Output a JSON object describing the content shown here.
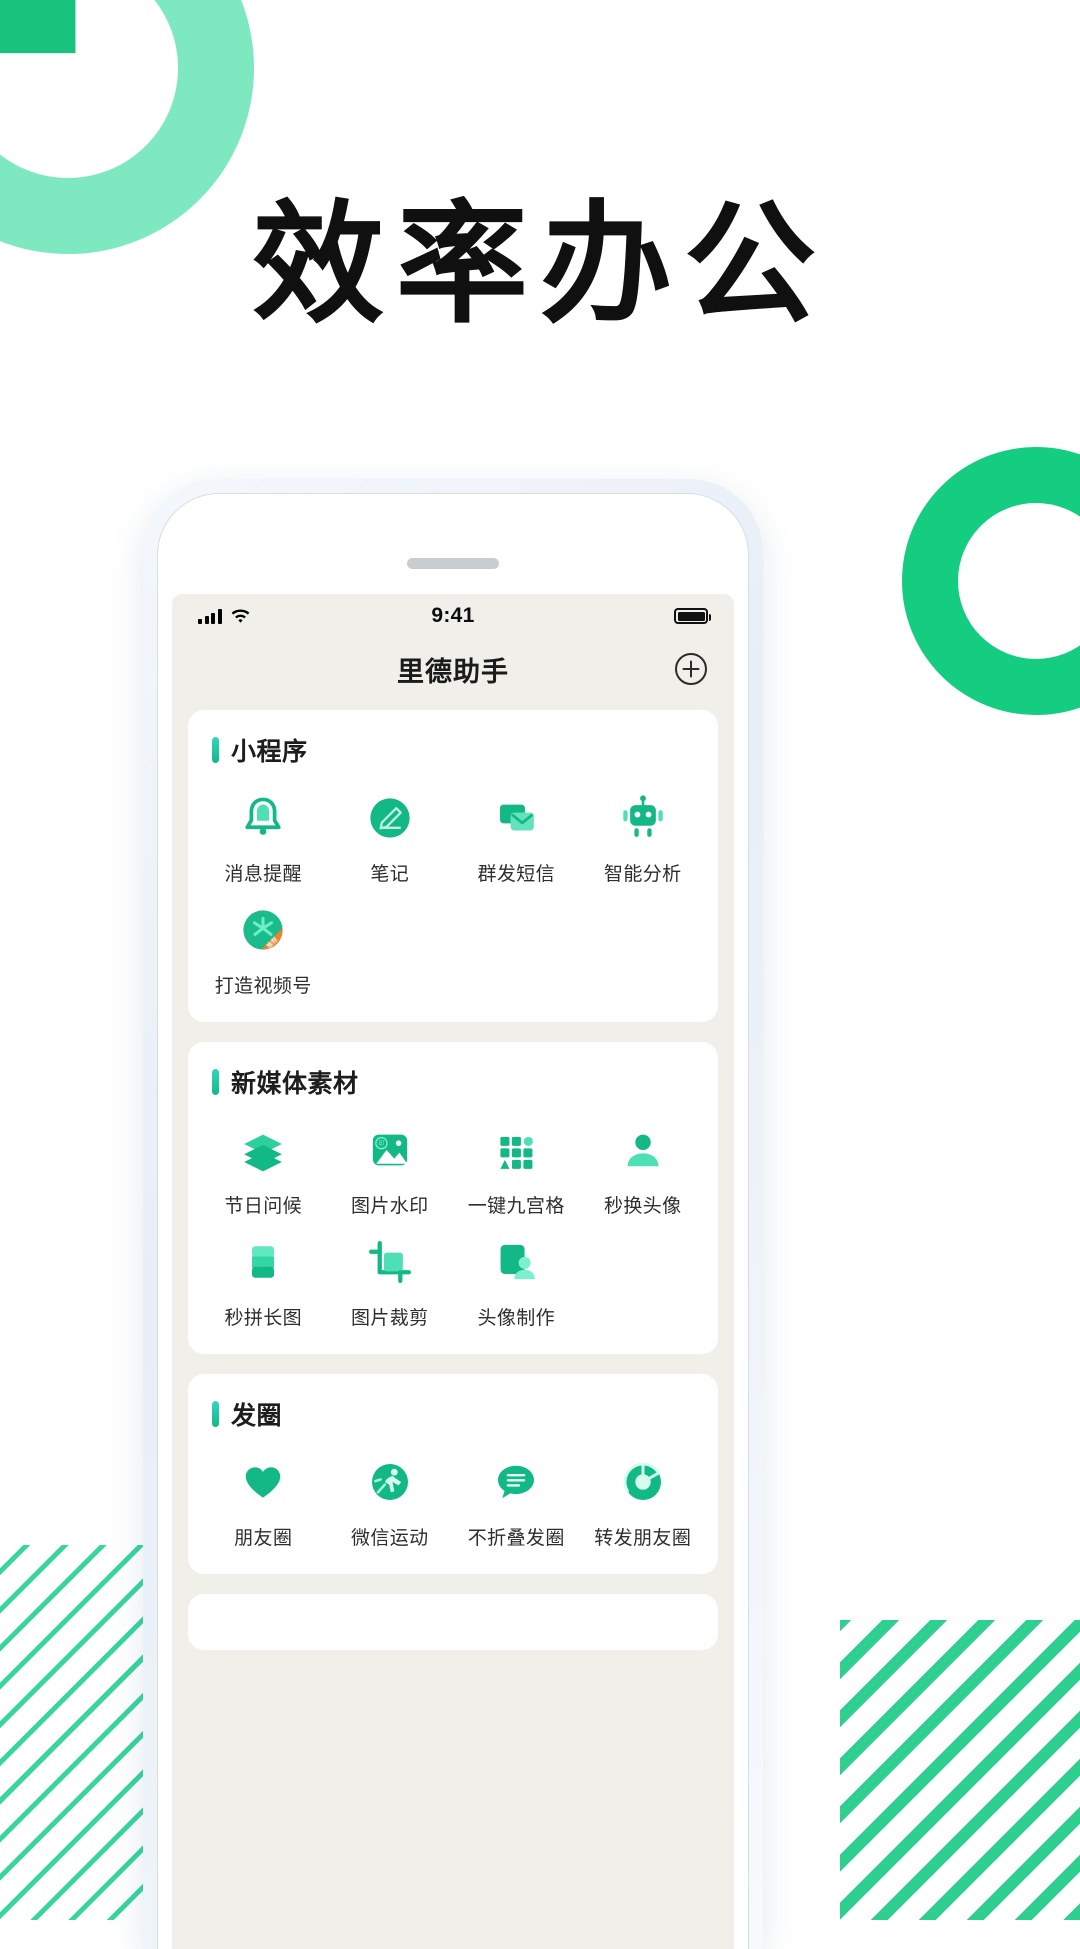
{
  "hero": {
    "title": "效率办公"
  },
  "colors": {
    "brand_green": "#12b886",
    "brand_light": "#7ee8c0",
    "accent_teal": "#34d6c0",
    "deco_green": "#19c37d",
    "orange": "#f0802e",
    "screen_bg": "#f0efe9",
    "card_bg": "#ffffff"
  },
  "phone": {
    "status_bar": {
      "time": "9:41",
      "signal_icon": "cellular-bars-icon",
      "wifi_icon": "wifi-icon",
      "battery_icon": "battery-full-icon"
    },
    "navbar": {
      "title": "里德助手",
      "add_icon": "plus-circle-icon"
    },
    "sections": [
      {
        "title": "小程序",
        "items": [
          {
            "label": "消息提醒",
            "icon": "bell-icon"
          },
          {
            "label": "笔记",
            "icon": "pencil-circle-icon"
          },
          {
            "label": "群发短信",
            "icon": "mail-stack-icon"
          },
          {
            "label": "智能分析",
            "icon": "robot-icon"
          },
          {
            "label": "打造视频号",
            "icon": "video-channel-icon"
          }
        ]
      },
      {
        "title": "新媒体素材",
        "items": [
          {
            "label": "节日问候",
            "icon": "layers-icon"
          },
          {
            "label": "图片水印",
            "icon": "image-watermark-icon"
          },
          {
            "label": "一键九宫格",
            "icon": "nine-grid-icon"
          },
          {
            "label": "秒换头像",
            "icon": "avatar-swap-icon"
          },
          {
            "label": "秒拼长图",
            "icon": "long-image-icon"
          },
          {
            "label": "图片裁剪",
            "icon": "crop-icon"
          },
          {
            "label": "头像制作",
            "icon": "avatar-maker-icon"
          }
        ]
      },
      {
        "title": "发圈",
        "items": [
          {
            "label": "朋友圈",
            "icon": "heart-icon"
          },
          {
            "label": "微信运动",
            "icon": "running-icon"
          },
          {
            "label": "不折叠发圈",
            "icon": "chat-bubble-icon"
          },
          {
            "label": "转发朋友圈",
            "icon": "shutter-icon"
          }
        ]
      }
    ]
  }
}
